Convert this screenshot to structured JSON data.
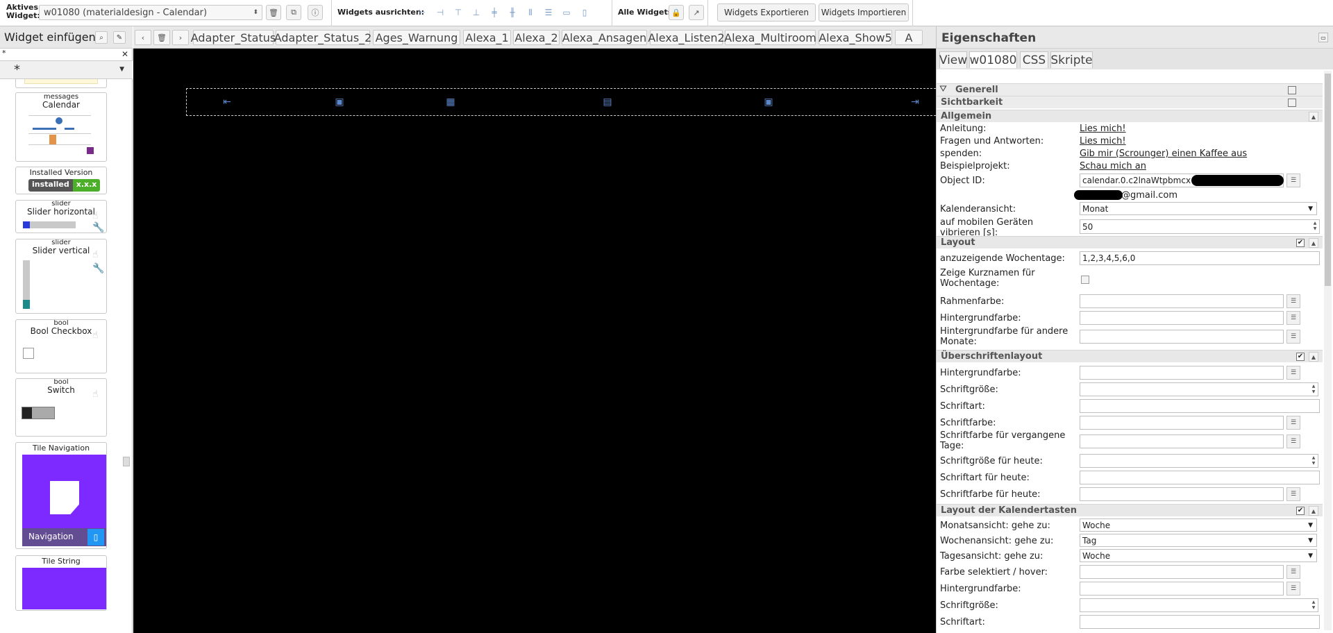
{
  "toolbar": {
    "active_widget_label": "Aktives Widget:",
    "active_widget_value": "w01080 (materialdesign - Calendar)",
    "align_label": "Widgets ausrichten:",
    "all_widgets_label": "Alle Widgets:",
    "export_label": "Widgets Exportieren",
    "import_label": "Widgets Importieren",
    "icons": {
      "delete": "trash-icon",
      "copy": "copy-icon",
      "info": "info-icon",
      "lock": "lock-icon",
      "external": "external-link-icon"
    }
  },
  "palette": {
    "title": "Widget einfügen",
    "search_value": "*",
    "filter_value": "*",
    "cards": {
      "calendar": {
        "small": "messages",
        "big": "Calendar"
      },
      "installed": {
        "big": "Installed Version",
        "badge_left": "installed",
        "badge_right": "x.x.x"
      },
      "slider_h": {
        "small": "slider",
        "big": "Slider horizontal"
      },
      "slider_v": {
        "small": "slider",
        "big": "Slider vertical"
      },
      "bool_checkbox": {
        "small": "bool",
        "big": "Bool Checkbox"
      },
      "switch": {
        "small": "bool",
        "big": "Switch"
      },
      "tile_nav": {
        "big": "Tile Navigation",
        "caption": "Navigation"
      },
      "tile_string": {
        "big": "Tile String"
      }
    }
  },
  "views": {
    "tabs": [
      "Adapter_Status",
      "Adapter_Status_2",
      "Ages_Warnung",
      "Alexa_1",
      "Alexa_2",
      "Alexa_Ansagen",
      "Alexa_Listen2",
      "Alexa_Multiroom",
      "Alexa_Show5",
      "A"
    ]
  },
  "props": {
    "title": "Eigenschaften",
    "tabs": [
      "View",
      "w01080",
      "CSS",
      "Skripte"
    ],
    "sections": {
      "generell": "Generell",
      "sichtbarkeit": "Sichtbarkeit",
      "allgemein": "Allgemein",
      "layout": "Layout",
      "header_layout": "Überschriftenlayout",
      "button_layout": "Layout der Kalendertasten"
    },
    "allgemein": {
      "anleitung_label": "Anleitung:",
      "anleitung_link": "Lies mich!",
      "faq_label": "Fragen und Antworten:",
      "faq_link": "Lies mich!",
      "spenden_label": "spenden:",
      "spenden_link": "Gib mir (Scrounger) einen Kaffee aus",
      "beispiel_label": "Beispielprojekt:",
      "beispiel_link": "Schau mich an",
      "object_id_label": "Object ID:",
      "object_id_value": "calendar.0.c2lnaWtpbmcx",
      "email_suffix": "@gmail.com",
      "ansicht_label": "Kalenderansicht:",
      "ansicht_value": "Monat",
      "vibrate_label": "auf mobilen Geräten vibrieren [s]:",
      "vibrate_value": "50"
    },
    "layout": {
      "wochentage_label": "anzuzeigende Wochentage:",
      "wochentage_value": "1,2,3,4,5,6,0",
      "kurznamen_label": "Zeige Kurznamen für Wochentage:",
      "rahmen_label": "Rahmenfarbe:",
      "hintergrund_label": "Hintergrundfarbe:",
      "hintergrund_andere_label": "Hintergrundfarbe für andere Monate:"
    },
    "header": {
      "hintergrund_label": "Hintergrundfarbe:",
      "groesse_label": "Schriftgröße:",
      "art_label": "Schriftart:",
      "farbe_label": "Schriftfarbe:",
      "farbe_vergangen_label": "Schriftfarbe für vergangene Tage:",
      "groesse_heute_label": "Schriftgröße für heute:",
      "art_heute_label": "Schriftart für heute:",
      "farbe_heute_label": "Schriftfarbe für heute:"
    },
    "buttons": {
      "monat_label": "Monatsansicht: gehe zu:",
      "monat_value": "Woche",
      "woche_label": "Wochenansicht: gehe zu:",
      "woche_value": "Tag",
      "tag_label": "Tagesansicht: gehe zu:",
      "tag_value": "Woche",
      "farbe_sel_label": "Farbe selektiert / hover:",
      "hintergrund_label": "Hintergrundfarbe:",
      "groesse_label": "Schriftgröße:",
      "art_label": "Schriftart:"
    }
  },
  "colors": {
    "canvas": "#000000",
    "accent_purple": "#7c2aff",
    "badge_green": "#4caf2a",
    "badge_dark": "#555555",
    "slider_blue": "#2a3bdb",
    "slider_teal": "#1a8a8a"
  }
}
